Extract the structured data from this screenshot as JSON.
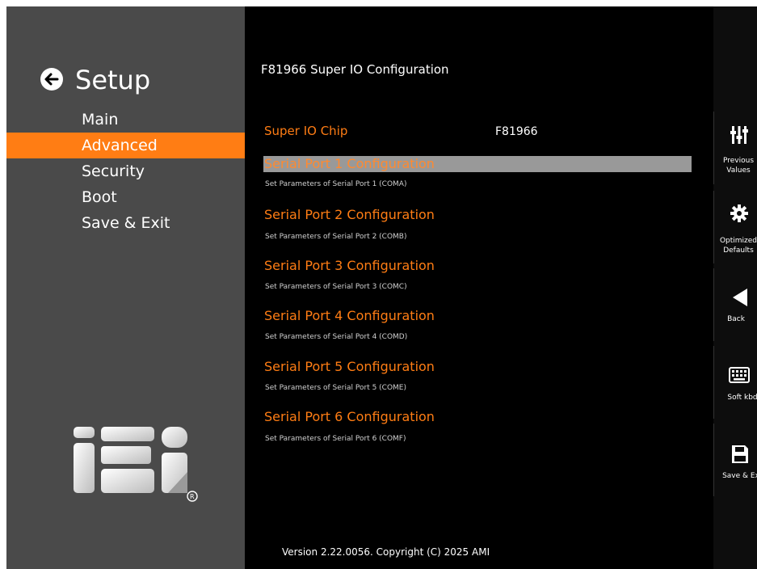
{
  "app": {
    "title": "Setup"
  },
  "menu": {
    "items": [
      {
        "label": "Main"
      },
      {
        "label": "Advanced"
      },
      {
        "label": "Security"
      },
      {
        "label": "Boot"
      },
      {
        "label": "Save & Exit"
      }
    ],
    "active_index": 1
  },
  "page": {
    "title": "F81966 Super IO Configuration",
    "chip_label": "Super IO Chip",
    "chip_value": "F81966",
    "entries": [
      {
        "label": "Serial Port 1 Configuration",
        "help": "Set Parameters of Serial Port 1 (COMA)",
        "selected": true
      },
      {
        "label": "Serial Port 2 Configuration",
        "help": "Set Parameters of Serial Port 2 (COMB)"
      },
      {
        "label": "Serial Port 3 Configuration",
        "help": "Set Parameters of Serial Port 3 (COMC)"
      },
      {
        "label": "Serial Port 4 Configuration",
        "help": "Set Parameters of Serial Port 4 (COMD)"
      },
      {
        "label": "Serial Port 5 Configuration",
        "help": "Set Parameters of Serial Port 5 (COME)"
      },
      {
        "label": "Serial Port 6 Configuration",
        "help": "Set Parameters of Serial Port 6 (COMF)"
      }
    ]
  },
  "footer": {
    "version": "Version 2.22.0056. Copyright (C) 2025 AMI"
  },
  "toolbar": {
    "previous_values": {
      "line1": "Previous",
      "line2": "Values",
      "icon": "sliders-icon"
    },
    "optimized_defaults": {
      "line1": "Optimized",
      "line2": "Defaults",
      "icon": "gear-icon"
    },
    "back": {
      "label": "Back",
      "icon": "back-triangle-icon"
    },
    "soft_kbd": {
      "label": "Soft kbd",
      "icon": "keyboard-icon"
    },
    "save_exit": {
      "label": "Save & Exit",
      "icon": "save-icon"
    }
  },
  "colors": {
    "accent": "#ff7d14",
    "sidebar": "#4a4a4a",
    "background": "#000000",
    "selection": "#999999"
  }
}
